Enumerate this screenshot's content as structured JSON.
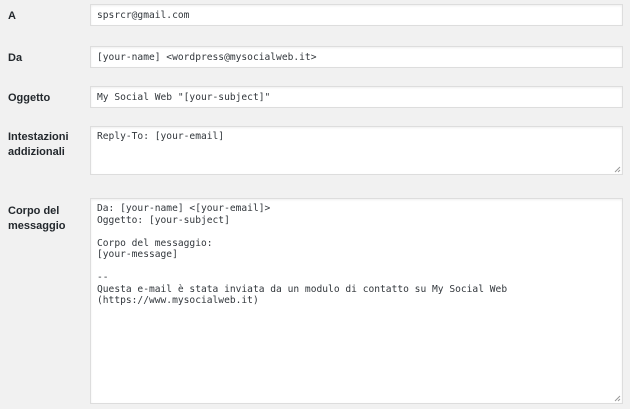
{
  "fields": {
    "to": {
      "label": "A",
      "value": "spsrcr@gmail.com"
    },
    "from": {
      "label": "Da",
      "value": "[your-name] <wordpress@mysocialweb.it>"
    },
    "subject": {
      "label": "Oggetto",
      "value": "My Social Web \"[your-subject]\""
    },
    "headers": {
      "label": "Intestazioni addizionali",
      "value": "Reply-To: [your-email]"
    },
    "body": {
      "label": "Corpo del messaggio",
      "value": "Da: [your-name] <[your-email]>\nOggetto: [your-subject]\n\nCorpo del messaggio:\n[your-message]\n\n--\nQuesta e-mail è stata inviata da un modulo di contatto su My Social Web (https://www.mysocialweb.it)"
    }
  },
  "icons": {
    "resize_handle": "resize-grip-icon"
  }
}
